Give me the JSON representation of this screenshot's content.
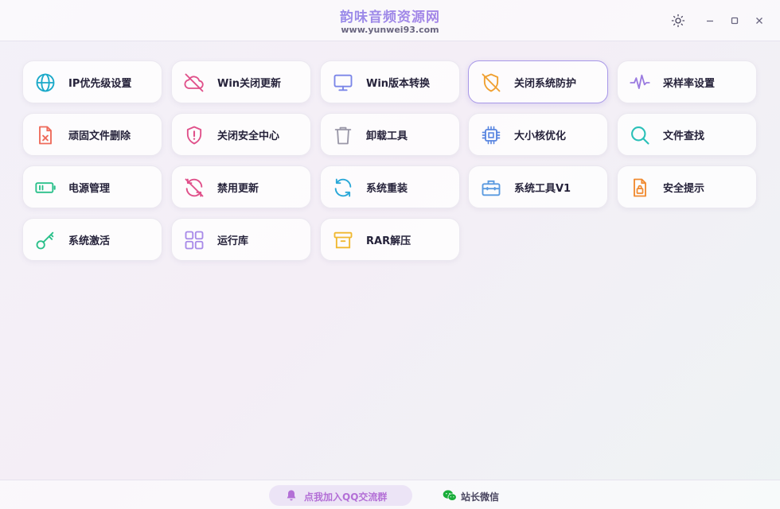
{
  "header": {
    "title": "韵味音频资源网",
    "subtitle": "www.yunwei93.com"
  },
  "window_controls": {
    "theme_icon": "sun-icon",
    "minimize_icon": "minimize-icon",
    "maximize_icon": "maximize-icon",
    "close_icon": "close-icon"
  },
  "tools": [
    {
      "label": "IP优先级设置",
      "icon": "globe-icon",
      "color": "#1aa9c9"
    },
    {
      "label": "Win关闭更新",
      "icon": "cloud-off-icon",
      "color": "#e0508a"
    },
    {
      "label": "Win版本转换",
      "icon": "monitor-icon",
      "color": "#7b86e8"
    },
    {
      "label": "关闭系统防护",
      "icon": "shield-off-icon",
      "color": "#f0a030",
      "selected": true
    },
    {
      "label": "采样率设置",
      "icon": "waveform-icon",
      "color": "#9b7be0"
    },
    {
      "label": "顽固文件删除",
      "icon": "file-x-icon",
      "color": "#ee6a5a"
    },
    {
      "label": "关闭安全中心",
      "icon": "shield-alert-icon",
      "color": "#e0508a"
    },
    {
      "label": "卸载工具",
      "icon": "trash-icon",
      "color": "#9a98a8"
    },
    {
      "label": "大小核优化",
      "icon": "cpu-icon",
      "color": "#5a86e0"
    },
    {
      "label": "文件查找",
      "icon": "search-icon",
      "color": "#2ac0b8"
    },
    {
      "label": "电源管理",
      "icon": "battery-icon",
      "color": "#2ac08a"
    },
    {
      "label": "禁用更新",
      "icon": "refresh-off-icon",
      "color": "#e0508a"
    },
    {
      "label": "系统重装",
      "icon": "refresh-icon",
      "color": "#2aa8d8"
    },
    {
      "label": "系统工具V1",
      "icon": "toolbox-icon",
      "color": "#5a9ae0"
    },
    {
      "label": "安全提示",
      "icon": "file-lock-icon",
      "color": "#f08a30"
    },
    {
      "label": "系统激活",
      "icon": "key-icon",
      "color": "#2ac08a"
    },
    {
      "label": "运行库",
      "icon": "grid-icon",
      "color": "#a88ae8"
    },
    {
      "label": "RAR解压",
      "icon": "archive-icon",
      "color": "#f0b830"
    }
  ],
  "footer": {
    "qq_label": "点我加入QQ交流群",
    "qq_icon": "bell-icon",
    "qq_color": "#b36fd6",
    "wechat_label": "站长微信",
    "wechat_icon": "wechat-icon",
    "wechat_color": "#1aad3a"
  }
}
